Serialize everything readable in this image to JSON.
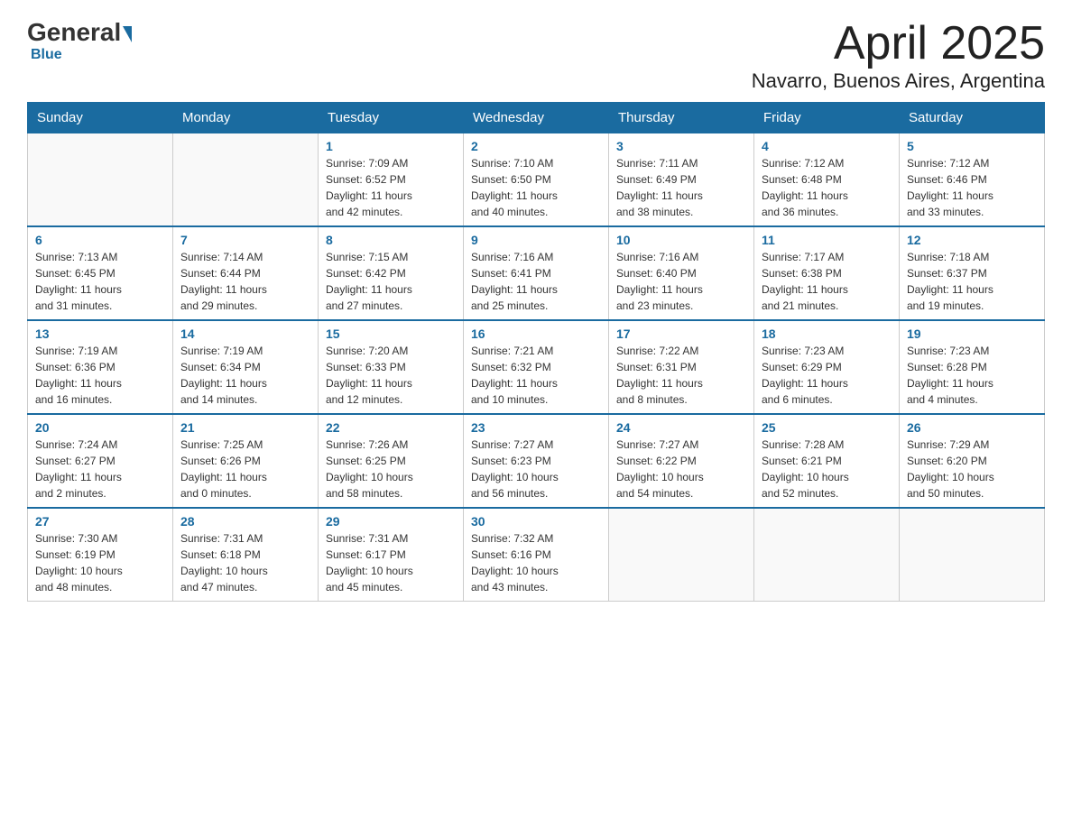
{
  "logo": {
    "general": "General",
    "blue": "Blue",
    "underline": "Blue"
  },
  "title": "April 2025",
  "subtitle": "Navarro, Buenos Aires, Argentina",
  "days_of_week": [
    "Sunday",
    "Monday",
    "Tuesday",
    "Wednesday",
    "Thursday",
    "Friday",
    "Saturday"
  ],
  "weeks": [
    [
      {
        "day": "",
        "info": ""
      },
      {
        "day": "",
        "info": ""
      },
      {
        "day": "1",
        "info": "Sunrise: 7:09 AM\nSunset: 6:52 PM\nDaylight: 11 hours\nand 42 minutes."
      },
      {
        "day": "2",
        "info": "Sunrise: 7:10 AM\nSunset: 6:50 PM\nDaylight: 11 hours\nand 40 minutes."
      },
      {
        "day": "3",
        "info": "Sunrise: 7:11 AM\nSunset: 6:49 PM\nDaylight: 11 hours\nand 38 minutes."
      },
      {
        "day": "4",
        "info": "Sunrise: 7:12 AM\nSunset: 6:48 PM\nDaylight: 11 hours\nand 36 minutes."
      },
      {
        "day": "5",
        "info": "Sunrise: 7:12 AM\nSunset: 6:46 PM\nDaylight: 11 hours\nand 33 minutes."
      }
    ],
    [
      {
        "day": "6",
        "info": "Sunrise: 7:13 AM\nSunset: 6:45 PM\nDaylight: 11 hours\nand 31 minutes."
      },
      {
        "day": "7",
        "info": "Sunrise: 7:14 AM\nSunset: 6:44 PM\nDaylight: 11 hours\nand 29 minutes."
      },
      {
        "day": "8",
        "info": "Sunrise: 7:15 AM\nSunset: 6:42 PM\nDaylight: 11 hours\nand 27 minutes."
      },
      {
        "day": "9",
        "info": "Sunrise: 7:16 AM\nSunset: 6:41 PM\nDaylight: 11 hours\nand 25 minutes."
      },
      {
        "day": "10",
        "info": "Sunrise: 7:16 AM\nSunset: 6:40 PM\nDaylight: 11 hours\nand 23 minutes."
      },
      {
        "day": "11",
        "info": "Sunrise: 7:17 AM\nSunset: 6:38 PM\nDaylight: 11 hours\nand 21 minutes."
      },
      {
        "day": "12",
        "info": "Sunrise: 7:18 AM\nSunset: 6:37 PM\nDaylight: 11 hours\nand 19 minutes."
      }
    ],
    [
      {
        "day": "13",
        "info": "Sunrise: 7:19 AM\nSunset: 6:36 PM\nDaylight: 11 hours\nand 16 minutes."
      },
      {
        "day": "14",
        "info": "Sunrise: 7:19 AM\nSunset: 6:34 PM\nDaylight: 11 hours\nand 14 minutes."
      },
      {
        "day": "15",
        "info": "Sunrise: 7:20 AM\nSunset: 6:33 PM\nDaylight: 11 hours\nand 12 minutes."
      },
      {
        "day": "16",
        "info": "Sunrise: 7:21 AM\nSunset: 6:32 PM\nDaylight: 11 hours\nand 10 minutes."
      },
      {
        "day": "17",
        "info": "Sunrise: 7:22 AM\nSunset: 6:31 PM\nDaylight: 11 hours\nand 8 minutes."
      },
      {
        "day": "18",
        "info": "Sunrise: 7:23 AM\nSunset: 6:29 PM\nDaylight: 11 hours\nand 6 minutes."
      },
      {
        "day": "19",
        "info": "Sunrise: 7:23 AM\nSunset: 6:28 PM\nDaylight: 11 hours\nand 4 minutes."
      }
    ],
    [
      {
        "day": "20",
        "info": "Sunrise: 7:24 AM\nSunset: 6:27 PM\nDaylight: 11 hours\nand 2 minutes."
      },
      {
        "day": "21",
        "info": "Sunrise: 7:25 AM\nSunset: 6:26 PM\nDaylight: 11 hours\nand 0 minutes."
      },
      {
        "day": "22",
        "info": "Sunrise: 7:26 AM\nSunset: 6:25 PM\nDaylight: 10 hours\nand 58 minutes."
      },
      {
        "day": "23",
        "info": "Sunrise: 7:27 AM\nSunset: 6:23 PM\nDaylight: 10 hours\nand 56 minutes."
      },
      {
        "day": "24",
        "info": "Sunrise: 7:27 AM\nSunset: 6:22 PM\nDaylight: 10 hours\nand 54 minutes."
      },
      {
        "day": "25",
        "info": "Sunrise: 7:28 AM\nSunset: 6:21 PM\nDaylight: 10 hours\nand 52 minutes."
      },
      {
        "day": "26",
        "info": "Sunrise: 7:29 AM\nSunset: 6:20 PM\nDaylight: 10 hours\nand 50 minutes."
      }
    ],
    [
      {
        "day": "27",
        "info": "Sunrise: 7:30 AM\nSunset: 6:19 PM\nDaylight: 10 hours\nand 48 minutes."
      },
      {
        "day": "28",
        "info": "Sunrise: 7:31 AM\nSunset: 6:18 PM\nDaylight: 10 hours\nand 47 minutes."
      },
      {
        "day": "29",
        "info": "Sunrise: 7:31 AM\nSunset: 6:17 PM\nDaylight: 10 hours\nand 45 minutes."
      },
      {
        "day": "30",
        "info": "Sunrise: 7:32 AM\nSunset: 6:16 PM\nDaylight: 10 hours\nand 43 minutes."
      },
      {
        "day": "",
        "info": ""
      },
      {
        "day": "",
        "info": ""
      },
      {
        "day": "",
        "info": ""
      }
    ]
  ]
}
